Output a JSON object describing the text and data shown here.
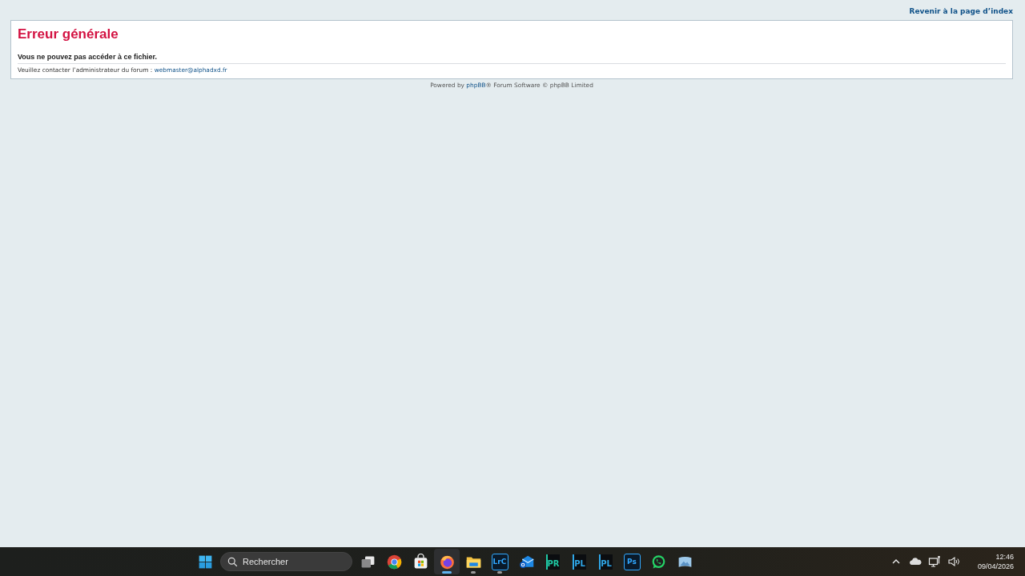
{
  "header": {
    "index_link": "Revenir à la page d’index"
  },
  "error_panel": {
    "title": "Erreur générale",
    "message": "Vous ne pouvez pas accéder à ce fichier.",
    "contact_text": "Veuillez contacter l’administrateur du forum : ",
    "contact_email": "webmaster@alphadxd.fr"
  },
  "footer": {
    "powered_by": "Powered by ",
    "phpbb_link": "phpBB",
    "rest": "® Forum Software © phpBB Limited"
  },
  "taskbar": {
    "search": {
      "placeholder": "Rechercher"
    },
    "apps": [
      {
        "kind": "start",
        "selected": false,
        "running": false
      },
      {
        "kind": "taskview",
        "selected": false,
        "running": false
      },
      {
        "kind": "chrome",
        "selected": false,
        "running": false
      },
      {
        "kind": "store",
        "selected": false,
        "running": false
      },
      {
        "kind": "firefox",
        "selected": true,
        "running": true
      },
      {
        "kind": "folder",
        "selected": false,
        "running": true
      },
      {
        "kind": "tile",
        "label": "LrC",
        "color": "#31a8ff",
        "selected": false,
        "running": true
      },
      {
        "kind": "mail",
        "selected": false,
        "running": false
      },
      {
        "kind": "dxo",
        "label": "PR",
        "color": "#1fc9a4",
        "selected": false,
        "running": false
      },
      {
        "kind": "dxo",
        "label": "PL",
        "color": "#2fa7e8",
        "selected": false,
        "running": false
      },
      {
        "kind": "dxo",
        "label": "PL",
        "color": "#2fa7e8",
        "selected": false,
        "running": false
      },
      {
        "kind": "tile",
        "label": "Ps",
        "color": "#31a8ff",
        "selected": false,
        "running": false
      },
      {
        "kind": "whatsapp",
        "selected": false,
        "running": false
      },
      {
        "kind": "photos",
        "selected": false,
        "running": false
      }
    ],
    "tray": {
      "time": "12:46",
      "date": "09/04/2026"
    }
  }
}
